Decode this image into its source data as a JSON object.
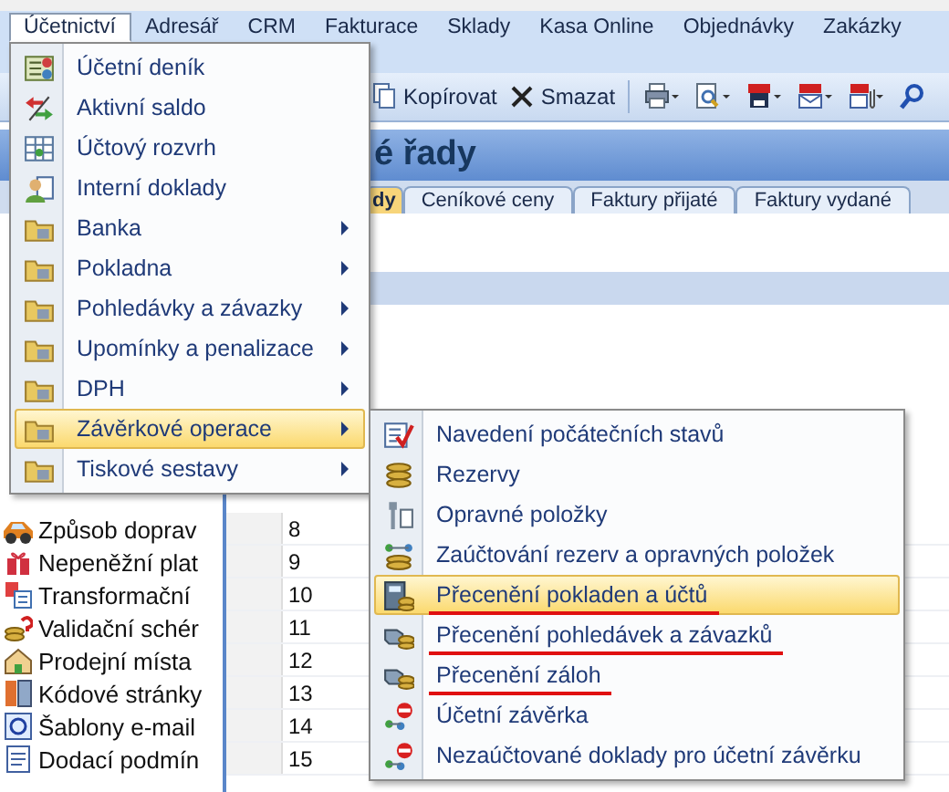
{
  "menubar": [
    {
      "label": "Účetnictví",
      "selected": true
    },
    {
      "label": "Adresář",
      "selected": false
    },
    {
      "label": "CRM",
      "selected": false
    },
    {
      "label": "Fakturace",
      "selected": false
    },
    {
      "label": "Sklady",
      "selected": false
    },
    {
      "label": "Kasa Online",
      "selected": false
    },
    {
      "label": "Objednávky",
      "selected": false
    },
    {
      "label": "Zakázky",
      "selected": false
    }
  ],
  "toolbar": {
    "buttons": [
      {
        "label": "Kopírovat"
      },
      {
        "label": "Smazat"
      }
    ]
  },
  "title": "é řady",
  "tabs": [
    {
      "label": "dy",
      "selected": true
    },
    {
      "label": "Ceníkové ceny",
      "selected": false
    },
    {
      "label": "Faktury přijaté",
      "selected": false
    },
    {
      "label": "Faktury vydané",
      "selected": false
    }
  ],
  "list": [
    {
      "name": "Způsob doprav",
      "number": "8"
    },
    {
      "name": "Nepeněžní plat",
      "number": "9"
    },
    {
      "name": "Transformační",
      "number": "10"
    },
    {
      "name": "Validační schér",
      "number": "11"
    },
    {
      "name": "Prodejní místa",
      "number": "12"
    },
    {
      "name": "Kódové stránky",
      "number": "13"
    },
    {
      "name": "Šablony e-mail",
      "number": "14"
    },
    {
      "name": "Dodací podmín",
      "number": "15"
    }
  ],
  "menu": {
    "items": [
      {
        "label": "Účetní deník",
        "submenu": false,
        "selected": false
      },
      {
        "label": "Aktivní saldo",
        "submenu": false,
        "selected": false
      },
      {
        "label": "Účtový rozvrh",
        "submenu": false,
        "selected": false
      },
      {
        "label": "Interní doklady",
        "submenu": false,
        "selected": false
      },
      {
        "label": "Banka",
        "submenu": true,
        "selected": false
      },
      {
        "label": "Pokladna",
        "submenu": true,
        "selected": false
      },
      {
        "label": "Pohledávky a závazky",
        "submenu": true,
        "selected": false
      },
      {
        "label": "Upomínky a penalizace",
        "submenu": true,
        "selected": false
      },
      {
        "label": "DPH",
        "submenu": true,
        "selected": false
      },
      {
        "label": "Závěrkové operace",
        "submenu": true,
        "selected": true
      },
      {
        "label": "Tiskové sestavy",
        "submenu": true,
        "selected": false
      }
    ]
  },
  "submenu": {
    "items": [
      {
        "label": "Navedení počátečních stavů",
        "selected": false,
        "underlined": false
      },
      {
        "label": "Rezervy",
        "selected": false,
        "underlined": false
      },
      {
        "label": "Opravné položky",
        "selected": false,
        "underlined": false
      },
      {
        "label": "Zaúčtování rezerv a opravných položek",
        "selected": false,
        "underlined": false
      },
      {
        "label": "Přecenění pokladen a účtů",
        "selected": true,
        "underlined": true
      },
      {
        "label": "Přecenění pohledávek a závazků",
        "selected": false,
        "underlined": true
      },
      {
        "label": "Přecenění záloh",
        "selected": false,
        "underlined": true
      },
      {
        "label": "Účetní závěrka",
        "selected": false,
        "underlined": false
      },
      {
        "label": "Nezaúčtované doklady pro účetní závěrku",
        "selected": false,
        "underlined": false
      }
    ]
  }
}
